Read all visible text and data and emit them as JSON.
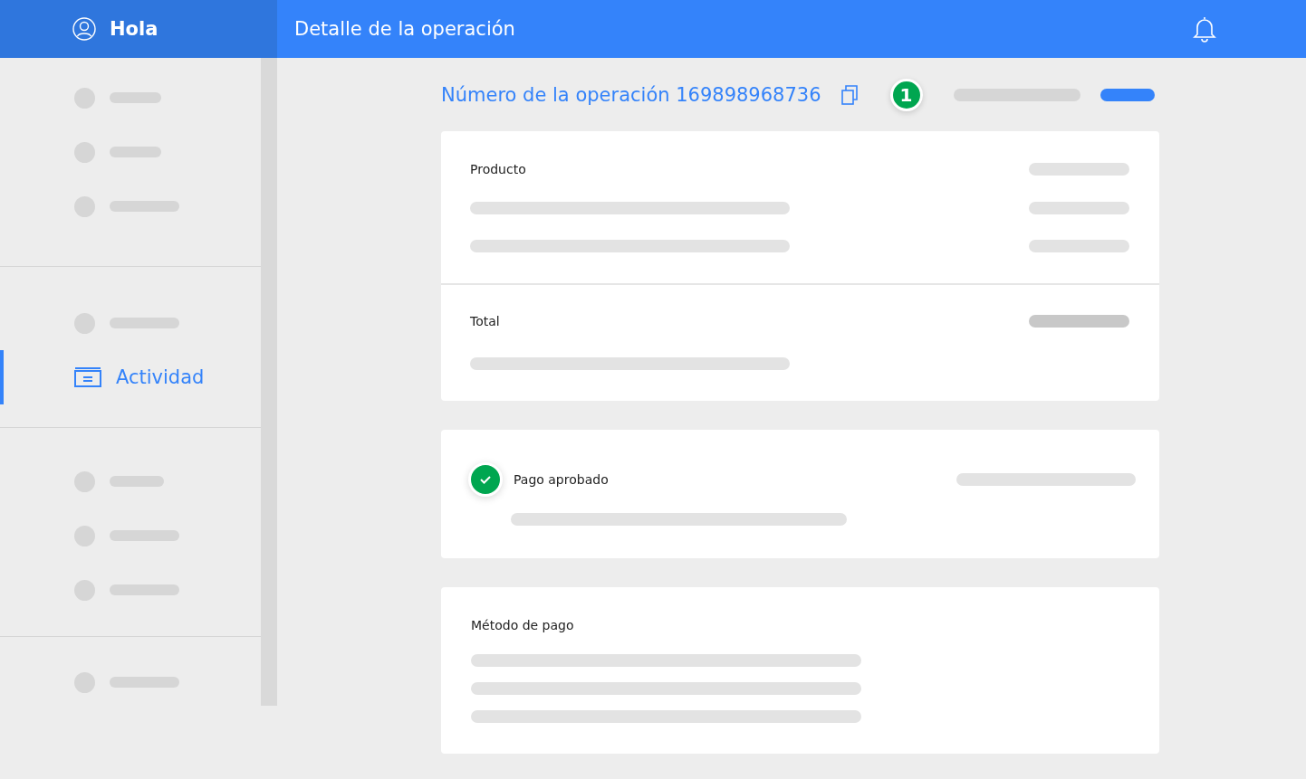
{
  "header": {
    "greeting": "Hola",
    "title": "Detalle de la operación"
  },
  "sidebar": {
    "sections": [
      {
        "items": [
          {
            "kind": "placeholder",
            "selected": false
          },
          {
            "kind": "placeholder",
            "selected": false
          },
          {
            "kind": "placeholder",
            "selected": false
          }
        ]
      },
      {
        "items": [
          {
            "kind": "placeholder",
            "selected": false
          },
          {
            "kind": "link",
            "label": "Actividad",
            "selected": true
          }
        ]
      },
      {
        "items": [
          {
            "kind": "placeholder",
            "selected": false
          },
          {
            "kind": "placeholder",
            "selected": false
          },
          {
            "kind": "placeholder",
            "selected": false
          }
        ]
      },
      {
        "items": [
          {
            "kind": "placeholder",
            "selected": false
          }
        ]
      }
    ]
  },
  "operation": {
    "label": "Número de la operación 169898968736",
    "badge": "1"
  },
  "cards": [
    {
      "kind": "breakdown",
      "sections": [
        {
          "label": "Producto"
        },
        {
          "label": "Total"
        }
      ]
    },
    {
      "kind": "status",
      "label": "Pago aprobado",
      "approved": true
    },
    {
      "kind": "method",
      "label": "Método de pago"
    }
  ]
}
